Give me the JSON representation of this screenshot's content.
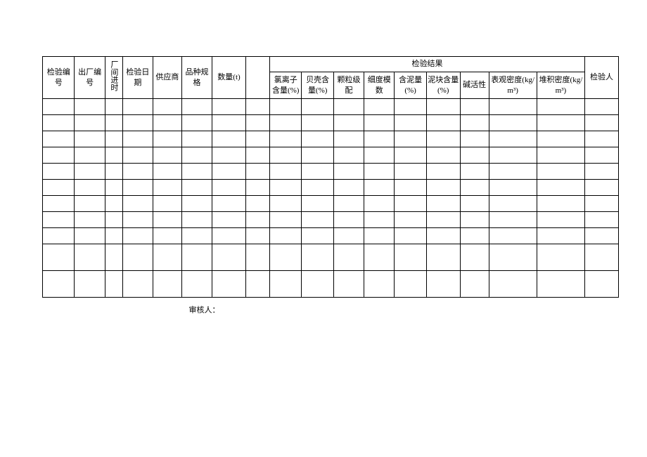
{
  "headers": {
    "col1": "检验编号",
    "col2": "出厂编号",
    "col3": "厂间进时",
    "col4": "检验日期",
    "col5": "供应商",
    "col6": "品种规格",
    "col7": "数量(t)",
    "col8": "",
    "results_group": "检验结果",
    "r1": "氯离子含量(%)",
    "r2": "贝壳含量(%)",
    "r3": "颗粒级配",
    "r4": "细度模数",
    "r5": "含泥量(%)",
    "r6": "泥块含量(%)",
    "r7": "碱活性",
    "r8": "表观密度(kg/m³)",
    "r9": "堆积密度(kg/m³)",
    "col_last": "检验人"
  },
  "footer": {
    "reviewer_label": "审核人："
  },
  "rows": [
    {},
    {},
    {},
    {},
    {},
    {},
    {},
    {},
    {},
    {},
    {}
  ]
}
